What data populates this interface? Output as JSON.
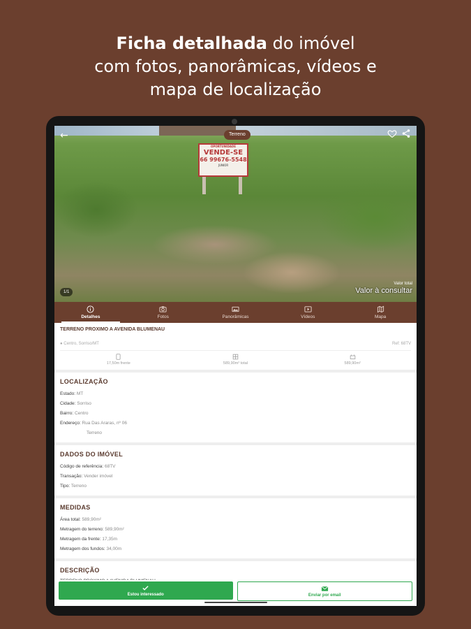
{
  "headline": {
    "bold": "Ficha detalhada",
    "rest1": " do imóvel",
    "line2": "com fotos, panorâmicas, vídeos e",
    "line3": "mapa de localização"
  },
  "photo": {
    "sign_top": "OPORTUNIDADE",
    "sign_main": "VENDE-SE",
    "sign_phone": "66 99676-5548",
    "sign_name": "JUNIOR",
    "type_badge": "Terreno",
    "photo_count": "1/1",
    "price_label": "Valor total",
    "price_value": "Valor à consultar"
  },
  "tabs": [
    {
      "label": "Detalhes",
      "icon": "info-icon"
    },
    {
      "label": "Fotos",
      "icon": "camera-icon"
    },
    {
      "label": "Panorâmicas",
      "icon": "panorama-icon"
    },
    {
      "label": "Vídeos",
      "icon": "video-icon"
    },
    {
      "label": "Mapa",
      "icon": "map-icon"
    }
  ],
  "summary": {
    "title": "TERRENO PROXIMO A AVENIDA BLUMENAU",
    "location": "Centro, Sorriso/MT",
    "ref": "Ref: 68TV",
    "stats": [
      "17,50m frente",
      "589,90m² total",
      "589,90m²"
    ]
  },
  "localizacao": {
    "title": "LOCALIZAÇÃO",
    "rows": [
      {
        "k": "Estado:",
        "v": "MT"
      },
      {
        "k": "Cidade:",
        "v": "Sorriso"
      },
      {
        "k": "Bairro:",
        "v": "Centro"
      },
      {
        "k": "Endereço:",
        "v": "Rua Das Araras, nº 06"
      }
    ],
    "extra": "Terreno"
  },
  "dados": {
    "title": "DADOS DO IMÓVEL",
    "rows": [
      {
        "k": "Código de referência:",
        "v": "68TV"
      },
      {
        "k": "Transação:",
        "v": "Vender imóvel"
      },
      {
        "k": "Tipo:",
        "v": "Terreno"
      }
    ]
  },
  "medidas": {
    "title": "MEDIDAS",
    "rows": [
      {
        "k": "Área total:",
        "v": "589,90m²"
      },
      {
        "k": "Metragem do terreno:",
        "v": "589,90m²"
      },
      {
        "k": "Metragem da frente:",
        "v": "17,35m"
      },
      {
        "k": "Metragem dos fundos:",
        "v": "34,00m"
      }
    ]
  },
  "descricao": {
    "title": "DESCRIÇÃO",
    "text": "TERRENO PROXIMO A AVENIDA BLUMENAU"
  },
  "buttons": {
    "interested": "Estou interessado",
    "email": "Enviar por email"
  },
  "colors": {
    "brand": "#6b3f2e",
    "accent": "#2fa84f"
  }
}
